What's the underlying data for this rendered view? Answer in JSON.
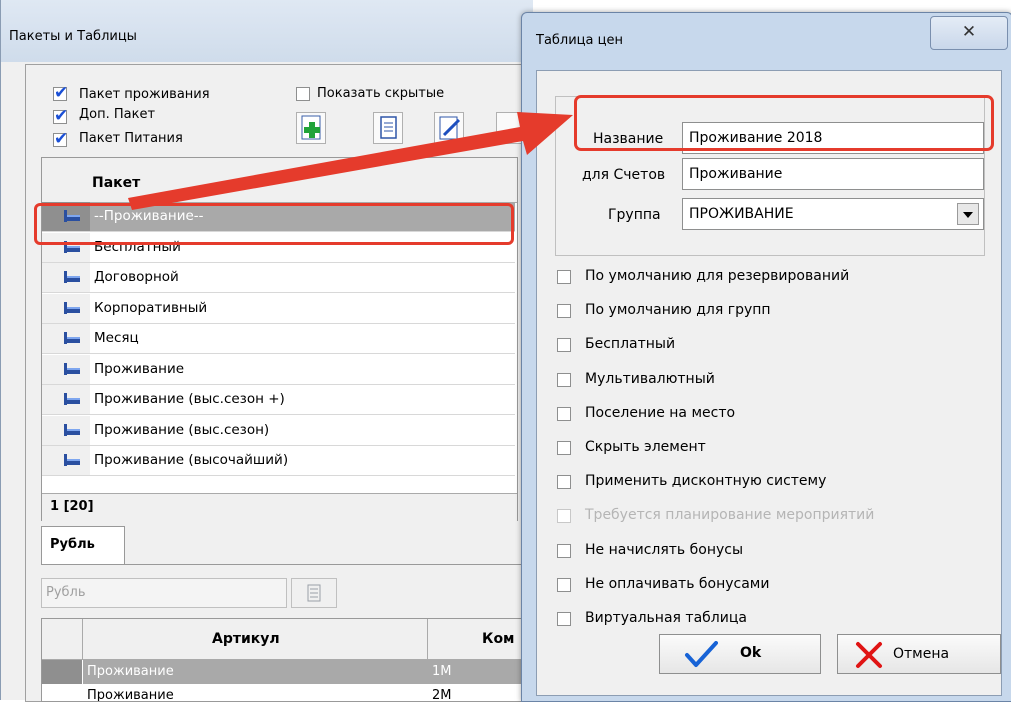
{
  "bg_window": {
    "title": "Пакеты и Таблицы",
    "filters": [
      {
        "label": "Пакет проживания",
        "checked": true
      },
      {
        "label": "Доп. Пакет",
        "checked": true
      },
      {
        "label": "Пакет Питания",
        "checked": true
      }
    ],
    "show_hidden": {
      "label": "Показать скрытые",
      "checked": false
    },
    "grid": {
      "column": "Пакет",
      "rows": [
        "--Проживание--",
        "Бесплатный",
        "Договорной",
        "Корпоративный",
        "Месяц",
        "Проживание",
        "Проживание (выс.сезон +)",
        "Проживание (выс.сезон)",
        "Проживание (высочайший)"
      ],
      "footer": "1 [20]"
    },
    "tab_label": "Рубль",
    "currency_field": "Рубль",
    "bottom_grid": {
      "columns": [
        "Артикул",
        "Ком"
      ],
      "rows": [
        {
          "article": "Проживание",
          "code": "1М"
        },
        {
          "article": "Проживание",
          "code": "2М"
        }
      ]
    }
  },
  "dialog": {
    "title": "Таблица цен",
    "close_glyph": "✕",
    "name": {
      "label": "Название",
      "value": "Проживание 2018"
    },
    "for_accounts": {
      "label": "для Счетов",
      "value": "Проживание"
    },
    "group": {
      "label": "Группа",
      "value": "ПРОЖИВАНИЕ"
    },
    "options": [
      {
        "label": "По умолчанию для резервирований",
        "checked": false,
        "disabled": false
      },
      {
        "label": "По умолчанию для групп",
        "checked": false,
        "disabled": false
      },
      {
        "label": "Бесплатный",
        "checked": false,
        "disabled": false
      },
      {
        "label": "Мультивалютный",
        "checked": false,
        "disabled": false
      },
      {
        "label": "Поселение на место",
        "checked": false,
        "disabled": false
      },
      {
        "label": "Скрыть элемент",
        "checked": false,
        "disabled": false
      },
      {
        "label": "Применить дисконтную систему",
        "checked": false,
        "disabled": false
      },
      {
        "label": "Требуется планирование мероприятий",
        "checked": false,
        "disabled": true
      },
      {
        "label": "Не начислять бонусы",
        "checked": false,
        "disabled": false
      },
      {
        "label": "Не оплачивать бонусами",
        "checked": false,
        "disabled": false
      },
      {
        "label": "Виртуальная таблица",
        "checked": false,
        "disabled": false
      }
    ],
    "ok_label": "Ok",
    "cancel_label": "Отмена"
  },
  "colors": {
    "highlight": "#e53b2c",
    "selected_row": "#a9a9a9",
    "ok_check": "#1763d6",
    "cancel_x": "#e01414"
  }
}
